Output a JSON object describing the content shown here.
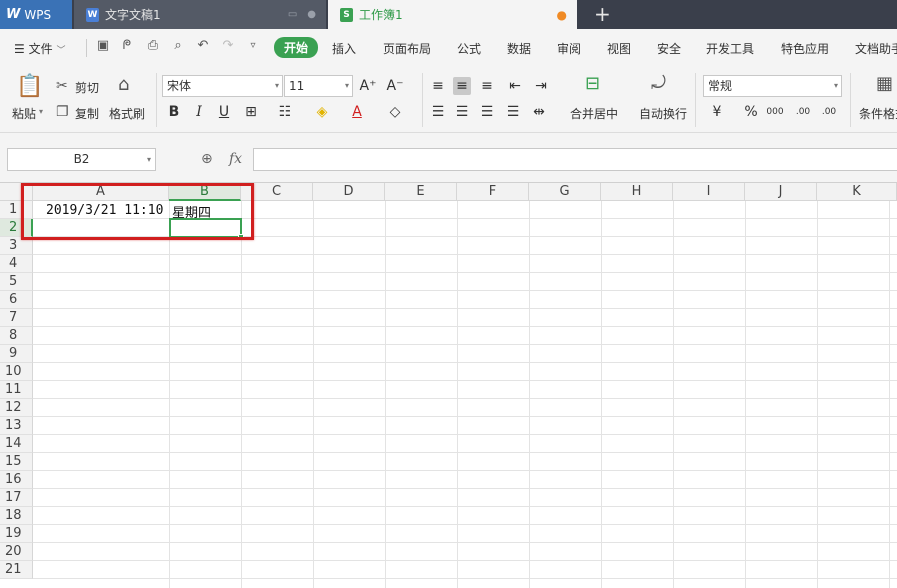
{
  "titlebar": {
    "wps_label": "WPS",
    "tabs": [
      {
        "label": "文字文稿1",
        "icon": "writer-doc-icon"
      },
      {
        "label": "工作簿1",
        "icon": "spreadsheet-icon",
        "unsaved_marker": "●"
      }
    ],
    "new_tab": "+"
  },
  "menu": {
    "file": "文件",
    "items": [
      "开始",
      "插入",
      "页面布局",
      "公式",
      "数据",
      "审阅",
      "视图",
      "安全",
      "开发工具",
      "特色应用",
      "文档助手"
    ],
    "active": "开始"
  },
  "ribbon": {
    "paste": "粘贴",
    "cut": "剪切",
    "copy": "复制",
    "format_painter": "格式刷",
    "font_name": "宋体",
    "font_size": "11",
    "merge_center": "合并居中",
    "wrap_text": "自动换行",
    "number_format": "常规",
    "cond_format": "条件格式",
    "percent": "%",
    "thousands": "000",
    "inc_decimal": ".00",
    "dec_decimal": ".00"
  },
  "formula_bar": {
    "name_box": "B2",
    "fx": "fx",
    "formula": ""
  },
  "sheet": {
    "columns": [
      "A",
      "B",
      "C",
      "D",
      "E",
      "F",
      "G",
      "H",
      "I",
      "J",
      "K"
    ],
    "rows": [
      "1",
      "2",
      "3",
      "4",
      "5",
      "6",
      "7",
      "8",
      "9",
      "10",
      "11",
      "12",
      "13",
      "14",
      "15",
      "16",
      "17",
      "18",
      "19",
      "20",
      "21"
    ],
    "active_column": "B",
    "active_row": "2",
    "cells": {
      "A1": "2019/3/21 11:10",
      "B1": "星期四"
    }
  },
  "colors": {
    "accent": "#3aa152",
    "highlight_box": "#d11f1f",
    "titlebar": "#3a3f4b"
  }
}
